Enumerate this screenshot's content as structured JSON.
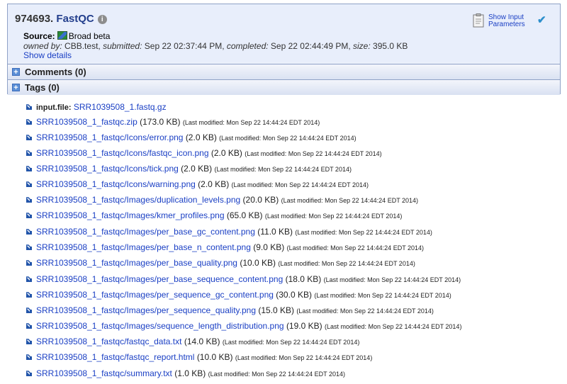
{
  "job": {
    "id": "974693.",
    "name": "FastQC",
    "source_label": "Source:",
    "source_value": "Broad beta",
    "meta": {
      "owned_by_label": "owned by:",
      "owned_by": "CBB.test",
      "submitted_label": "submitted:",
      "submitted": "Sep 22 02:37:44 PM",
      "completed_label": "completed:",
      "completed": "Sep 22 02:44:49 PM",
      "size_label": "size:",
      "size": "395.0 KB"
    },
    "show_details": "Show details",
    "show_input_line1": "Show Input",
    "show_input_line2": "Parameters"
  },
  "sections": {
    "comments": "Comments (0)",
    "tags": "Tags (0)"
  },
  "input_file": {
    "label": "input.file:",
    "name": "SRR1039508_1.fastq.gz"
  },
  "files": [
    {
      "name": "SRR1039508_1_fastqc.zip",
      "size": "(173.0 KB)",
      "modified": "(Last modified: Mon Sep 22 14:44:24 EDT 2014)"
    },
    {
      "name": "SRR1039508_1_fastqc/Icons/error.png",
      "size": "(2.0 KB)",
      "modified": "(Last modified: Mon Sep 22 14:44:24 EDT 2014)"
    },
    {
      "name": "SRR1039508_1_fastqc/Icons/fastqc_icon.png",
      "size": "(2.0 KB)",
      "modified": "(Last modified: Mon Sep 22 14:44:24 EDT 2014)"
    },
    {
      "name": "SRR1039508_1_fastqc/Icons/tick.png",
      "size": "(2.0 KB)",
      "modified": "(Last modified: Mon Sep 22 14:44:24 EDT 2014)"
    },
    {
      "name": "SRR1039508_1_fastqc/Icons/warning.png",
      "size": "(2.0 KB)",
      "modified": "(Last modified: Mon Sep 22 14:44:24 EDT 2014)"
    },
    {
      "name": "SRR1039508_1_fastqc/Images/duplication_levels.png",
      "size": "(20.0 KB)",
      "modified": "(Last modified: Mon Sep 22 14:44:24 EDT 2014)"
    },
    {
      "name": "SRR1039508_1_fastqc/Images/kmer_profiles.png",
      "size": "(65.0 KB)",
      "modified": "(Last modified: Mon Sep 22 14:44:24 EDT 2014)"
    },
    {
      "name": "SRR1039508_1_fastqc/Images/per_base_gc_content.png",
      "size": "(11.0 KB)",
      "modified": "(Last modified: Mon Sep 22 14:44:24 EDT 2014)"
    },
    {
      "name": "SRR1039508_1_fastqc/Images/per_base_n_content.png",
      "size": "(9.0 KB)",
      "modified": "(Last modified: Mon Sep 22 14:44:24 EDT 2014)"
    },
    {
      "name": "SRR1039508_1_fastqc/Images/per_base_quality.png",
      "size": "(10.0 KB)",
      "modified": "(Last modified: Mon Sep 22 14:44:24 EDT 2014)"
    },
    {
      "name": "SRR1039508_1_fastqc/Images/per_base_sequence_content.png",
      "size": "(18.0 KB)",
      "modified": "(Last modified: Mon Sep 22 14:44:24 EDT 2014)"
    },
    {
      "name": "SRR1039508_1_fastqc/Images/per_sequence_gc_content.png",
      "size": "(30.0 KB)",
      "modified": "(Last modified: Mon Sep 22 14:44:24 EDT 2014)"
    },
    {
      "name": "SRR1039508_1_fastqc/Images/per_sequence_quality.png",
      "size": "(15.0 KB)",
      "modified": "(Last modified: Mon Sep 22 14:44:24 EDT 2014)"
    },
    {
      "name": "SRR1039508_1_fastqc/Images/sequence_length_distribution.png",
      "size": "(19.0 KB)",
      "modified": "(Last modified: Mon Sep 22 14:44:24 EDT 2014)"
    },
    {
      "name": "SRR1039508_1_fastqc/fastqc_data.txt",
      "size": "(14.0 KB)",
      "modified": "(Last modified: Mon Sep 22 14:44:24 EDT 2014)"
    },
    {
      "name": "SRR1039508_1_fastqc/fastqc_report.html",
      "size": "(10.0 KB)",
      "modified": "(Last modified: Mon Sep 22 14:44:24 EDT 2014)"
    },
    {
      "name": "SRR1039508_1_fastqc/summary.txt",
      "size": "(1.0 KB)",
      "modified": "(Last modified: Mon Sep 22 14:44:24 EDT 2014)"
    }
  ],
  "icons": {
    "info": "info-icon",
    "source_flag": "broad-flag-icon",
    "clipboard": "clipboard-icon",
    "check": "check-icon",
    "expand": "plus-icon",
    "download": "download-arrow-icon"
  },
  "colors": {
    "link": "#1a3fc4",
    "panel_bg": "#ebf0fa",
    "panel_border": "#8fa2c7",
    "check": "#2d8fcc"
  }
}
